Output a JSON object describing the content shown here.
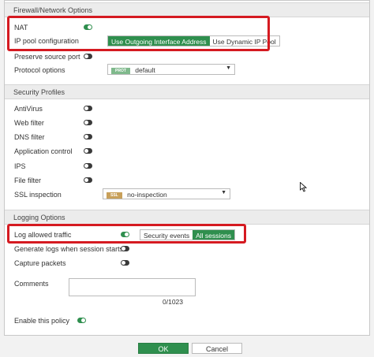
{
  "firewall": {
    "header": "Firewall/Network Options",
    "nat_label": "NAT",
    "ip_pool_label": "IP pool configuration",
    "ip_pool_options": [
      "Use Outgoing Interface Address",
      "Use Dynamic IP Pool"
    ],
    "preserve_port_label": "Preserve source port",
    "protocol_label": "Protocol options",
    "protocol_tag": "PROT",
    "protocol_value": "default"
  },
  "security": {
    "header": "Security Profiles",
    "items": [
      {
        "label": "AntiVirus"
      },
      {
        "label": "Web filter"
      },
      {
        "label": "DNS filter"
      },
      {
        "label": "Application control"
      },
      {
        "label": "IPS"
      },
      {
        "label": "File filter"
      }
    ],
    "ssl_label": "SSL inspection",
    "ssl_tag": "SSL",
    "ssl_value": "no-inspection"
  },
  "logging": {
    "header": "Logging Options",
    "log_allowed_label": "Log allowed traffic",
    "log_options": [
      "Security events",
      "All sessions"
    ],
    "generate_logs_label": "Generate logs when session starts",
    "capture_packets_label": "Capture packets"
  },
  "comments": {
    "label": "Comments",
    "counter": "0/1023"
  },
  "enable_policy_label": "Enable this policy",
  "footer": {
    "ok": "OK",
    "cancel": "Cancel"
  },
  "colors": {
    "accent_green": "#2f8f4e",
    "highlight_red": "#d51a21",
    "prot_tag": "#7fb98c",
    "ssl_tag": "#c8a05a"
  }
}
